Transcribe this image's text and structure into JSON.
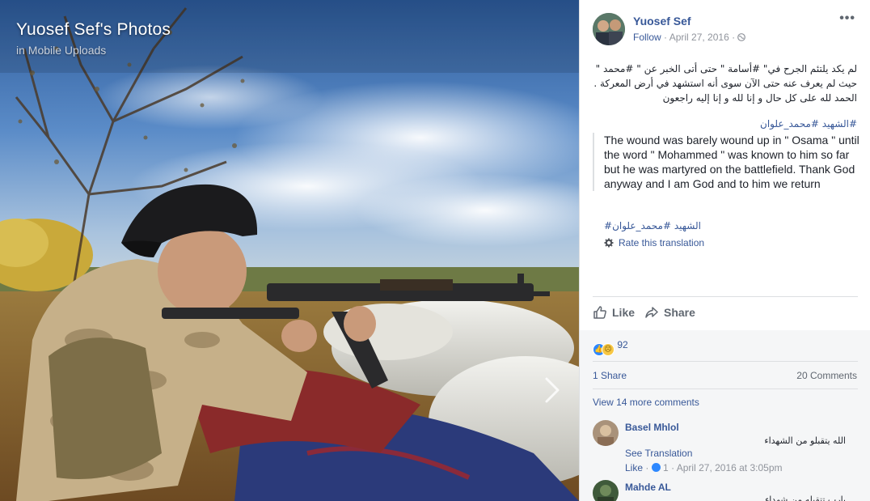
{
  "photo": {
    "title": "Yuosef Sef's Photos",
    "album": "in Mobile Uploads"
  },
  "post": {
    "author": "Yuosef Sef",
    "follow_label": "Follow",
    "date": "April 27, 2016",
    "separator": "·",
    "more_label": "•••",
    "arabic_lines": [
      "لم يكد يلتئم الجرح في\" #أسامة \" حتى أتى الخبر عن \" #محمد \"",
      "حيث لم يعرف عنه حتى الآن سوى أنه استشهد في أرض المعركة .",
      "الحمد لله على كل حال و إنا لله و إنا إليه راجعون"
    ],
    "hashtags_ar": [
      "#الشهيد",
      "#محمد_علوان"
    ],
    "translation": "The wound was barely wound up in \" Osama \" until the word \" Mohammed \" was known to him so far but he was martyred on the battlefield. Thank God anyway and I am God and to him we return",
    "hashtags_translated": [
      "#الشهيد",
      "#محمد_علوان"
    ],
    "rate_translation": "Rate this translation"
  },
  "actions": {
    "like": "Like",
    "share": "Share"
  },
  "stats": {
    "reaction_count": "92",
    "shares": "1 Share",
    "comments": "20 Comments",
    "view_more": "View 14 more comments"
  },
  "comments": [
    {
      "name": "Basel Mhlol",
      "text": "الله يتقبلو من الشهداء",
      "see_translation": "See Translation",
      "like_label": "Like",
      "like_count": "1",
      "time": "April 27, 2016 at 3:05pm",
      "sep": "·"
    },
    {
      "name": "Mahde AL",
      "text": "يارب تتقبله من شهداء"
    }
  ],
  "colors": {
    "link": "#385898",
    "muted": "#90949c",
    "like_blue": "#2d88ff",
    "sad_yellow": "#f7c744"
  },
  "icons": [
    "globe-icon",
    "more-icon",
    "gear-icon",
    "thumbs-up-icon",
    "share-arrow-icon",
    "like-reaction-icon",
    "sad-reaction-icon",
    "chevron-right-icon"
  ]
}
